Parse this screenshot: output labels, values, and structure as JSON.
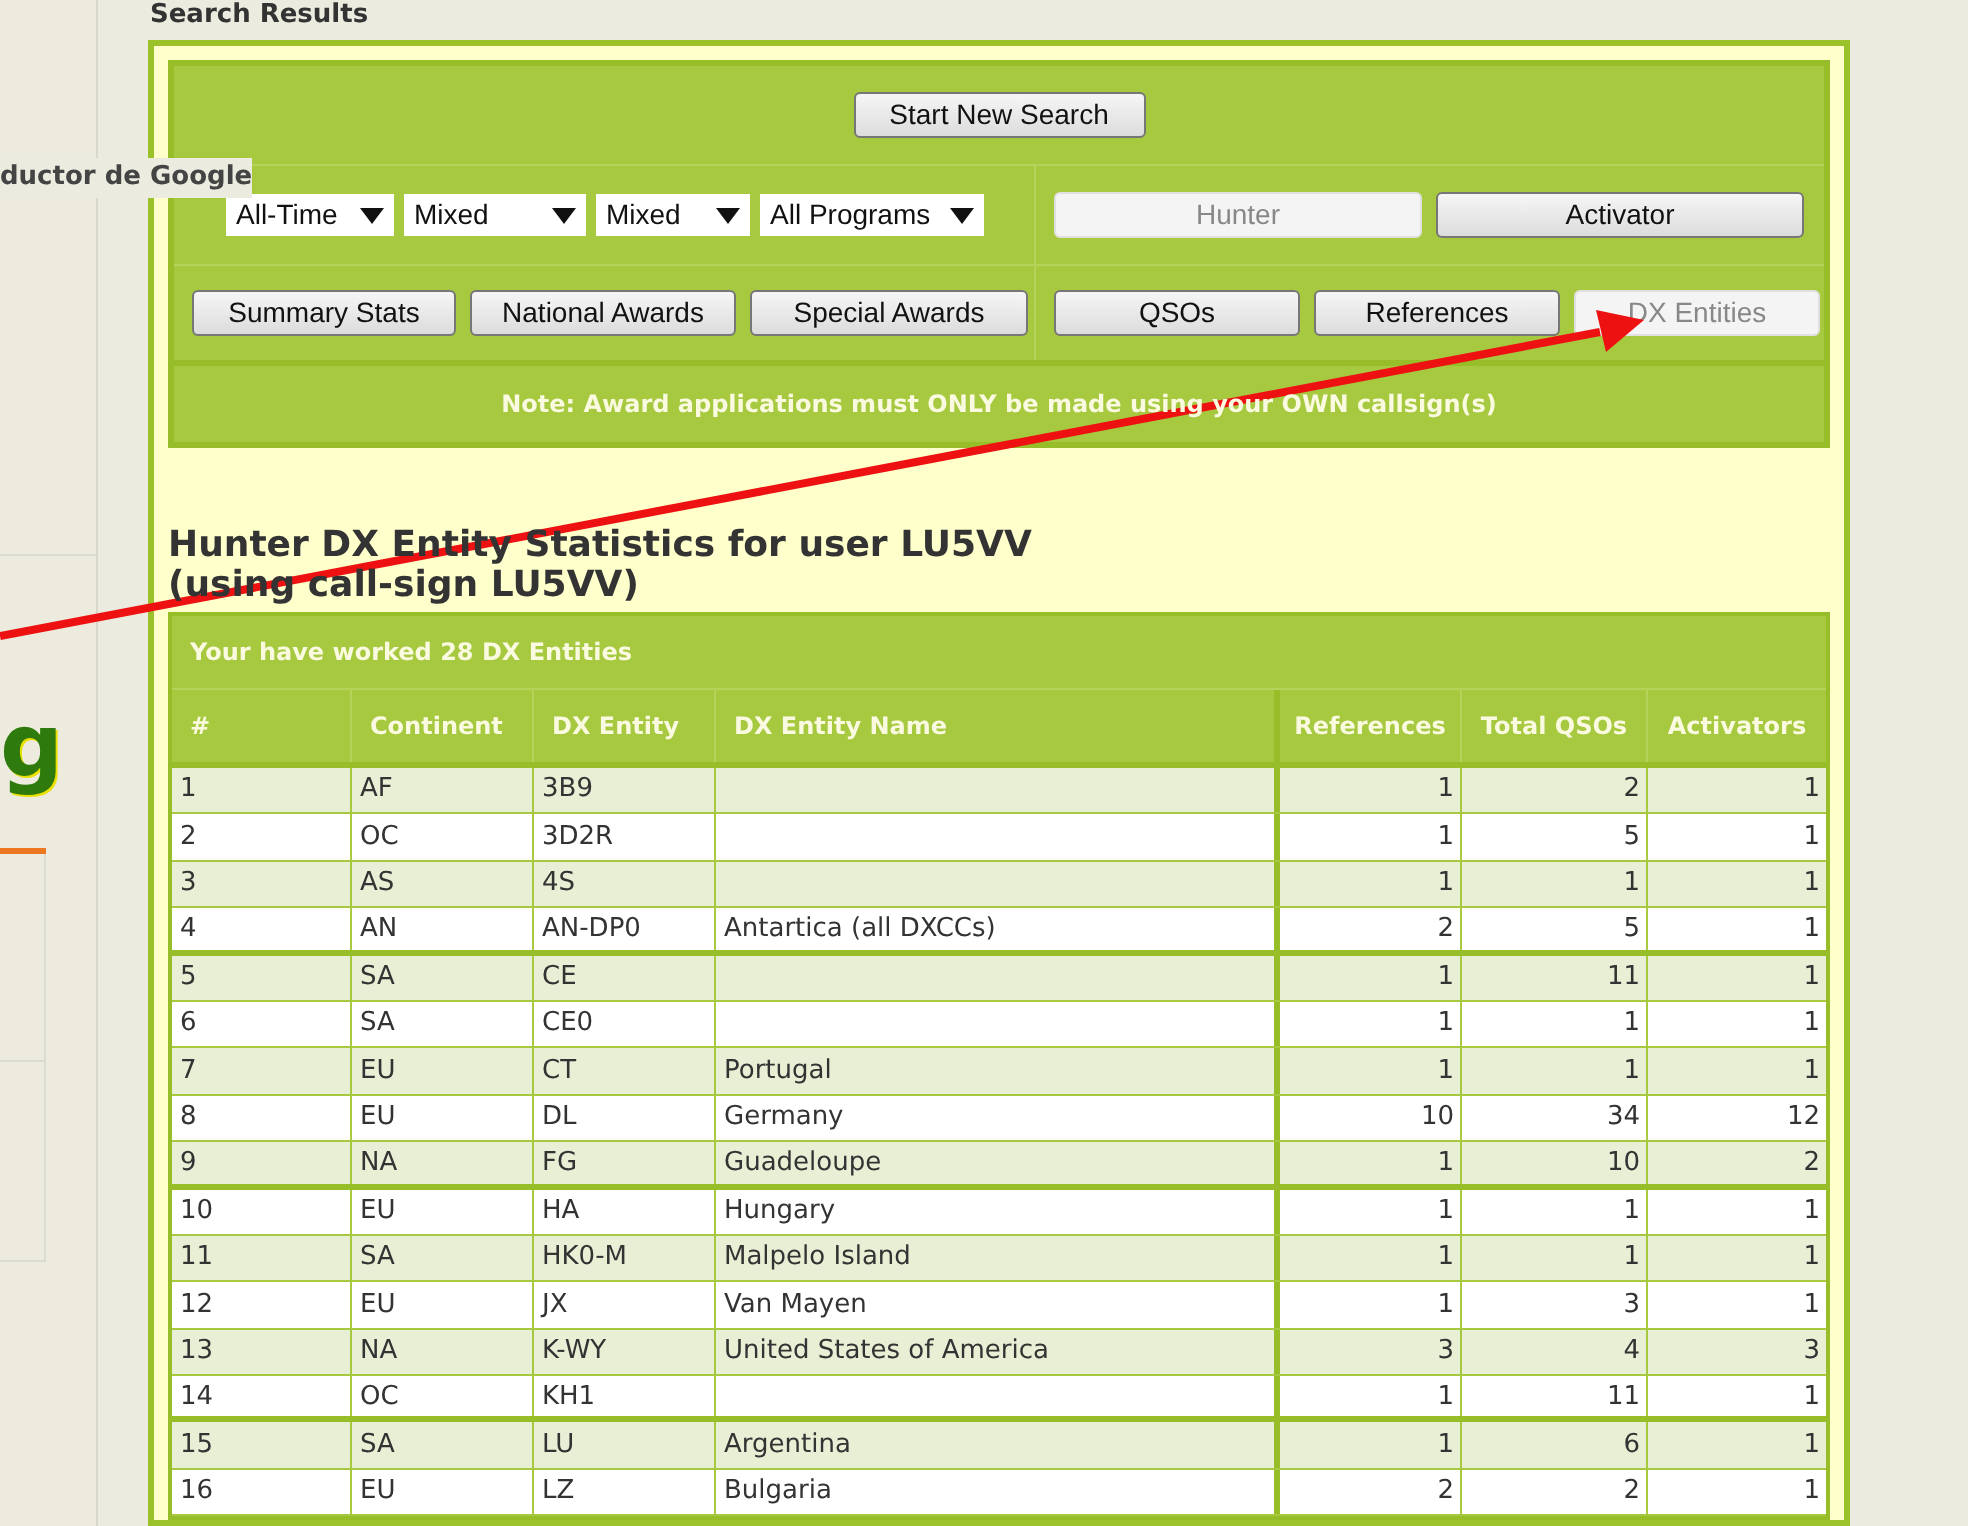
{
  "page_title": "Search Results",
  "sidebar": {
    "overlay_text": "ductor de Google",
    "logo_fragment": "g"
  },
  "search_panel": {
    "new_search_button": "Start New Search",
    "filters": [
      {
        "value": "All-Time"
      },
      {
        "value": "Mixed"
      },
      {
        "value": "Mixed"
      },
      {
        "value": "All Programs"
      }
    ],
    "role_tabs": [
      {
        "label": "Hunter",
        "selected": true
      },
      {
        "label": "Activator",
        "selected": false
      }
    ],
    "award_buttons": [
      "Summary Stats",
      "National Awards",
      "Special Awards"
    ],
    "view_tabs": [
      {
        "label": "QSOs",
        "selected": false
      },
      {
        "label": "References",
        "selected": false
      },
      {
        "label": "DX Entities",
        "selected": true
      }
    ],
    "note": "Note: Award applications must ONLY be made using your OWN callsign(s)"
  },
  "heading": [
    "Hunter DX Entity Statistics for user LU5VV",
    "(using call-sign LU5VV)"
  ],
  "table": {
    "caption": "Your have worked 28 DX Entities",
    "columns": [
      "#",
      "Continent",
      "DX Entity",
      "DX Entity Name",
      "References",
      "Total QSOs",
      "Activators"
    ],
    "rows": [
      {
        "cells": [
          "1",
          "AF",
          "3B9",
          "",
          "1",
          "2",
          "1"
        ],
        "group_end": false
      },
      {
        "cells": [
          "2",
          "OC",
          "3D2R",
          "",
          "1",
          "5",
          "1"
        ],
        "group_end": false
      },
      {
        "cells": [
          "3",
          "AS",
          "4S",
          "",
          "1",
          "1",
          "1"
        ],
        "group_end": false
      },
      {
        "cells": [
          "4",
          "AN",
          "AN-DP0",
          "Antartica (all DXCCs)",
          "2",
          "5",
          "1"
        ],
        "group_end": true
      },
      {
        "cells": [
          "5",
          "SA",
          "CE",
          "",
          "1",
          "11",
          "1"
        ],
        "group_end": false
      },
      {
        "cells": [
          "6",
          "SA",
          "CE0",
          "",
          "1",
          "1",
          "1"
        ],
        "group_end": false
      },
      {
        "cells": [
          "7",
          "EU",
          "CT",
          "Portugal",
          "1",
          "1",
          "1"
        ],
        "group_end": false
      },
      {
        "cells": [
          "8",
          "EU",
          "DL",
          "Germany",
          "10",
          "34",
          "12"
        ],
        "group_end": false
      },
      {
        "cells": [
          "9",
          "NA",
          "FG",
          "Guadeloupe",
          "1",
          "10",
          "2"
        ],
        "group_end": true
      },
      {
        "cells": [
          "10",
          "EU",
          "HA",
          "Hungary",
          "1",
          "1",
          "1"
        ],
        "group_end": false
      },
      {
        "cells": [
          "11",
          "SA",
          "HK0-M",
          "Malpelo Island",
          "1",
          "1",
          "1"
        ],
        "group_end": false
      },
      {
        "cells": [
          "12",
          "EU",
          "JX",
          "Van Mayen",
          "1",
          "3",
          "1"
        ],
        "group_end": false
      },
      {
        "cells": [
          "13",
          "NA",
          "K-WY",
          "United States of America",
          "3",
          "4",
          "3"
        ],
        "group_end": false
      },
      {
        "cells": [
          "14",
          "OC",
          "KH1",
          "",
          "1",
          "11",
          "1"
        ],
        "group_end": true
      },
      {
        "cells": [
          "15",
          "SA",
          "LU",
          "Argentina",
          "1",
          "6",
          "1"
        ],
        "group_end": false
      },
      {
        "cells": [
          "16",
          "EU",
          "LZ",
          "Bulgaria",
          "2",
          "2",
          "1"
        ],
        "group_end": false
      }
    ]
  }
}
